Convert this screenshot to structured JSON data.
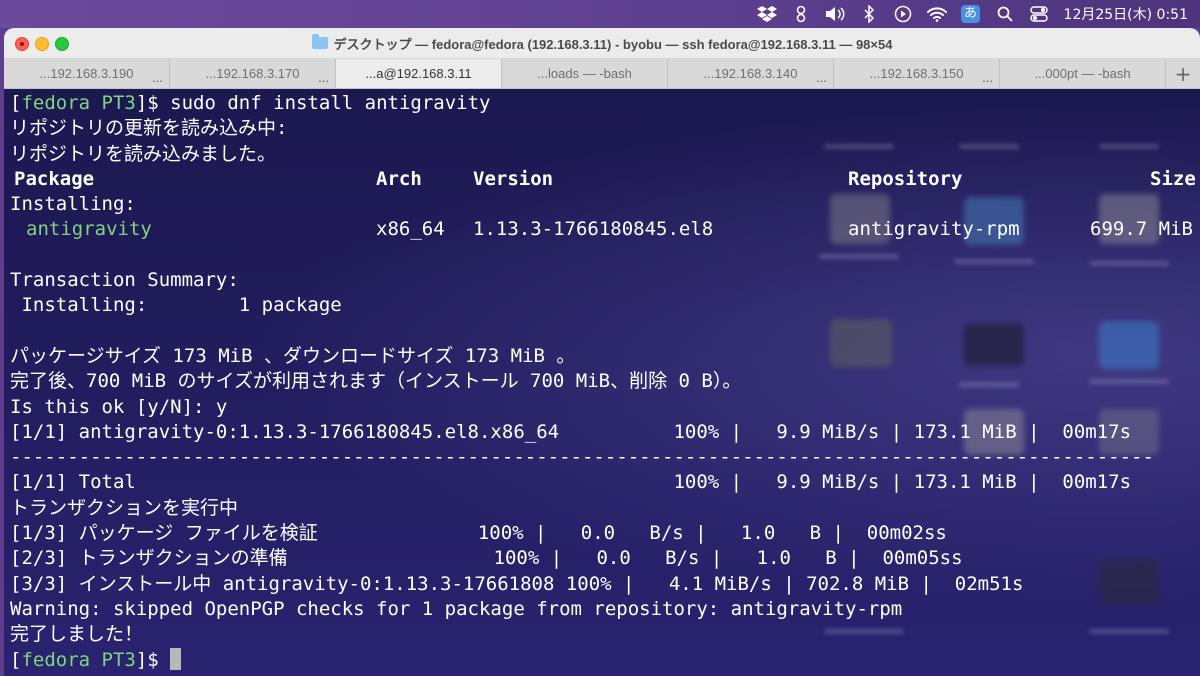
{
  "menubar": {
    "icons": [
      "dropbox-icon",
      "evernote-icon",
      "volume-icon",
      "bluetooth-icon",
      "play-icon",
      "wifi-icon",
      "input-method-icon",
      "search-icon",
      "control-center-icon"
    ],
    "input_method_label": "あ",
    "clock": "12月25日(木) 0:51"
  },
  "window": {
    "title": "デスクトップ — fedora@fedora (192.168.3.11) - byobu — ssh fedora@192.168.3.11 — 98×54",
    "tabs": [
      {
        "label": "...192.168.3.190",
        "dots": "..."
      },
      {
        "label": "...192.168.3.170",
        "dots": "..."
      },
      {
        "label": "...a@192.168.3.11",
        "dots": ""
      },
      {
        "label": "...loads — -bash",
        "dots": ""
      },
      {
        "label": "...192.168.3.140",
        "dots": "..."
      },
      {
        "label": "...192.168.3.150",
        "dots": "..."
      },
      {
        "label": "...000pt — -bash",
        "dots": ""
      }
    ],
    "add_tab": "+"
  },
  "terminal": {
    "prompt_open": "[",
    "prompt_host": "fedora PT3",
    "prompt_close": "]$",
    "command": " sudo dnf install antigravity",
    "l2": "リポジトリの更新を読み込み中:",
    "l3": "リポジトリを読み込みました。",
    "hdr_package": "Package",
    "hdr_arch": "Arch",
    "hdr_version": "Version",
    "hdr_repository": "Repository",
    "hdr_size": "Size",
    "installing_label": "Installing:",
    "pkg_name": "antigravity",
    "pkg_arch": "x86_64",
    "pkg_version": "1.13.3-1766180845.el8",
    "pkg_repo": "antigravity-rpm",
    "pkg_size": "699.7 MiB",
    "summary_title": "Transaction Summary:",
    "summary_installing": " Installing:        1 package",
    "l11": "パッケージサイズ 173 MiB 、ダウンロードサイズ 173 MiB 。",
    "l12": "完了後、700 MiB のサイズが利用されます（インストール 700 MiB、削除 0 B）。",
    "l13": "Is this ok [y/N]: y",
    "l14": "[1/1] antigravity-0:1.13.3-1766180845.el8.x86_64          100% |   9.9 MiB/s | 173.1 MiB |  00m17s",
    "l15": "----------------------------------------------------------------------------------------------------",
    "l16": "[1/1] Total                                               100% |   9.9 MiB/s | 173.1 MiB |  00m17s",
    "l17": "トランザクションを実行中",
    "l18": "[1/3] パッケージ ファイルを検証              100% |   0.0   B/s |   1.0   B |  00m02ss",
    "l19": "[2/3] トランザクションの準備                  100% |   0.0   B/s |   1.0   B |  00m05ss",
    "l20": "[3/3] インストール中 antigravity-0:1.13.3-17661808 100% |   4.1 MiB/s | 702.8 MiB |  02m51s",
    "l21": "Warning: skipped OpenPGP checks for 1 package from repository: antigravity-rpm",
    "l22": "完了しました！"
  }
}
